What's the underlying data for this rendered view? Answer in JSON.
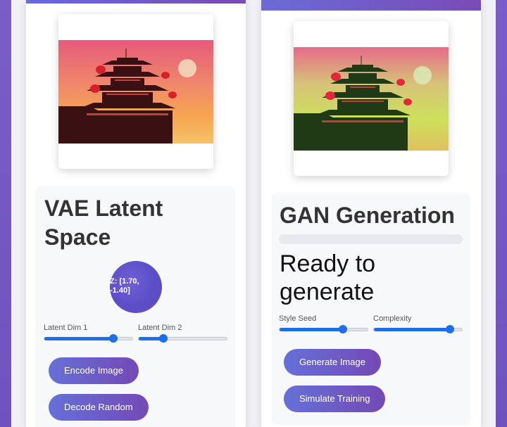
{
  "vae": {
    "title": "VAE Latent Space",
    "latent_readout": "Z: [1.70, -1.40]",
    "sliders": [
      {
        "label": "Latent Dim 1",
        "value": 0.78
      },
      {
        "label": "Latent Dim 2",
        "value": 0.28
      }
    ],
    "buttons": {
      "encode": "Encode Image",
      "decode": "Decode Random"
    }
  },
  "gan": {
    "title": "GAN Generation",
    "progress": 0,
    "status": "Ready to generate",
    "sliders": [
      {
        "label": "Style Seed",
        "value": 0.72
      },
      {
        "label": "Complexity",
        "value": 0.86
      }
    ],
    "buttons": {
      "generate": "Generate Image",
      "simulate": "Simulate Training"
    }
  },
  "colors": {
    "accent_gradient_start": "#6670d8",
    "accent_gradient_end": "#7449b5",
    "slider_fill": "#1e6fe6"
  }
}
